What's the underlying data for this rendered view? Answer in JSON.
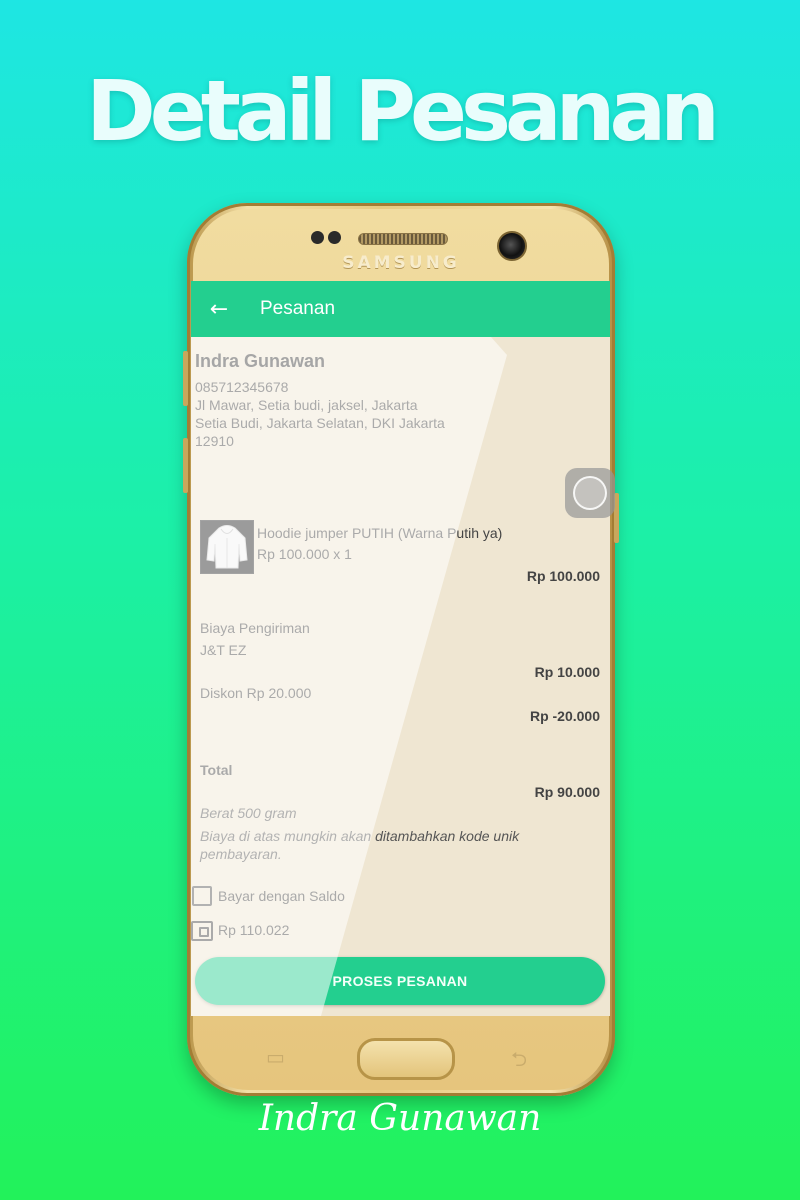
{
  "headline": "Detail Pesanan",
  "phone": {
    "brand": "SAMSUNG"
  },
  "appbar": {
    "title": "Pesanan"
  },
  "customer": {
    "name": "Indra Gunawan",
    "phone": "085712345678",
    "address_line1": "Jl Mawar, Setia budi, jaksel, Jakarta",
    "address_line2": "Setia Budi, Jakarta Selatan, DKI Jakarta",
    "postal_code": "12910"
  },
  "item": {
    "name": "Hoodie jumper  PUTIH (Warna Putih ya)",
    "price_qty": "Rp 100.000 x 1",
    "subtotal": "Rp 100.000"
  },
  "shipping": {
    "label": "Biaya Pengiriman",
    "courier": "J&T EZ",
    "cost": "Rp 10.000"
  },
  "discount": {
    "label": "Diskon Rp 20.000",
    "amount": "Rp -20.000"
  },
  "total": {
    "label": "Total",
    "amount": "Rp 90.000"
  },
  "notes": {
    "weight": "Berat 500 gram",
    "fee_note_line1": "Biaya di atas mungkin akan ditambahkan kode unik",
    "fee_note_line2": "pembayaran."
  },
  "saldo": {
    "checkbox_label": "Bayar dengan Saldo",
    "balance": "Rp 110.022"
  },
  "action": {
    "label": "PROSES PESANAN"
  },
  "signature": "Indra Gunawan",
  "colors": {
    "accent": "#23cf8f",
    "bg_top": "#1ee6e3",
    "bg_bottom": "#22f25a"
  }
}
